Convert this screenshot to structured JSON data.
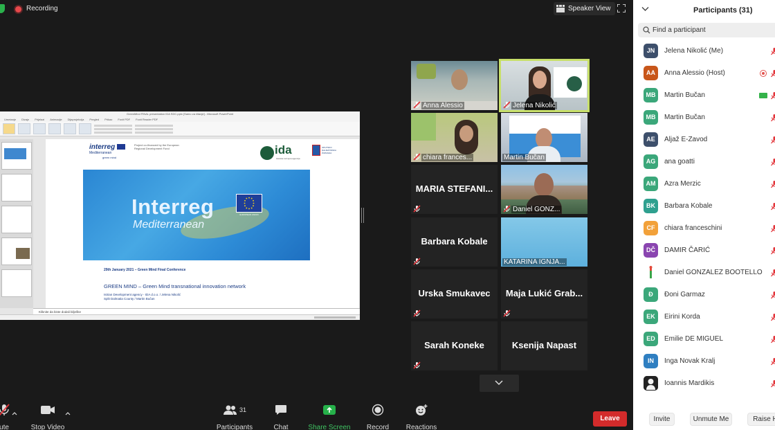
{
  "topbar": {
    "recording_label": "Recording",
    "speaker_view_label": "Speaker View"
  },
  "shared_screen": {
    "window_title": "GreenMind FINAL presentation IDA SDC.pptx [Samo za čitanje] - Microsoft PowerPoint",
    "tabs": [
      "Umetanje",
      "Dizajn",
      "Prijelazi",
      "Animacije",
      "Dijaprojekcija",
      "Pregled",
      "Prikaz",
      "Foxit PDF",
      "Foxit Reader PDF"
    ],
    "slide": {
      "interreg_logo": "interreg",
      "interreg_logo_sub": "Mediterranean",
      "greenmind_logo": "green mind",
      "project_funding": "Project co-financed by the European Regional Development Fund",
      "ida_logo": "ida",
      "ida_sub": "istarska razvojna agencija",
      "county_logo": "SPLITSKO DALMATINSKA ŽUPANIJA",
      "banner_title": "Interreg",
      "banner_sub": "Mediterranean",
      "eu_label": "EUROPEAN UNION",
      "date_line": "29th January 2021 – Green Mind Final Conference",
      "heading": "GREEN MIND – Green Mind transnational innovation network",
      "line1": "Istrian Development agency - IDA d.o.o. / Jelena Nikolić",
      "line2": "Split Dalmatia County / Martin Bučan"
    },
    "notes_placeholder": "Kliknite da biste dodali bilješke"
  },
  "video_grid": [
    {
      "name": "Anna Alessio",
      "type": "video",
      "muted": true
    },
    {
      "name": "Jelena Nikolić",
      "type": "video",
      "muted": true,
      "active": true
    },
    {
      "name": "chiara frances...",
      "type": "video",
      "muted": true
    },
    {
      "name": "Martin Bučan",
      "type": "video",
      "muted": false
    },
    {
      "name": "MARIA STEFANI...",
      "type": "name",
      "muted": true
    },
    {
      "name": "Daniel GONZ...",
      "type": "video",
      "muted": true
    },
    {
      "name": "Barbara Kobale",
      "type": "name",
      "muted": true
    },
    {
      "name": "KATARINA IGNJA...",
      "type": "video",
      "muted": false
    },
    {
      "name": "Urska Smukavec",
      "type": "name",
      "muted": true
    },
    {
      "name": "Maja Lukić Grab...",
      "type": "name",
      "muted": true
    },
    {
      "name": "Sarah Koneke",
      "type": "name",
      "muted": true
    },
    {
      "name": "Ksenija Napast",
      "type": "name",
      "muted": false
    }
  ],
  "toolbar": {
    "mute_label": "ute",
    "stop_video_label": "Stop Video",
    "participants_label": "Participants",
    "participants_count": "31",
    "chat_label": "Chat",
    "share_screen_label": "Share Screen",
    "record_label": "Record",
    "reactions_label": "Reactions",
    "leave_label": "Leave"
  },
  "panel": {
    "title": "Participants (31)",
    "search_placeholder": "Find a participant",
    "participants": [
      {
        "initials": "JN",
        "name": "Jelena Nikolić (Me)",
        "color": "#3d4f6b"
      },
      {
        "initials": "AA",
        "name": "Anna Alessio (Host)",
        "color": "#c8561a",
        "status": "recording"
      },
      {
        "initials": "MB",
        "name": "Martin Bučan",
        "color": "#3ba77a",
        "status": "video"
      },
      {
        "initials": "MB",
        "name": "Martin Bučan",
        "color": "#3ba77a"
      },
      {
        "initials": "AE",
        "name": "Aljaž E-Zavod",
        "color": "#3d4f6b"
      },
      {
        "initials": "AG",
        "name": "ana goatti",
        "color": "#3ba77a"
      },
      {
        "initials": "AM",
        "name": "Azra Merzic",
        "color": "#3ba77a"
      },
      {
        "initials": "BK",
        "name": "Barbara Kobale",
        "color": "#2fa08f"
      },
      {
        "initials": "CF",
        "name": "chiara franceschini",
        "color": "#f2a13a"
      },
      {
        "initials": "DČ",
        "name": "DAMIR ČARIĆ",
        "color": "#8a45b0"
      },
      {
        "initials": "",
        "name": "Daniel GONZALEZ BOOTELLO",
        "color": "#ffffff",
        "photo": true
      },
      {
        "initials": "Đ",
        "name": "Đoni Garmaz",
        "color": "#3ba77a"
      },
      {
        "initials": "EK",
        "name": "Eirini Korda",
        "color": "#3ba77a"
      },
      {
        "initials": "ED",
        "name": "Emilie DE MIGUEL",
        "color": "#3ba77a"
      },
      {
        "initials": "IN",
        "name": "Inga Novak Kralj",
        "color": "#2f7fc1"
      },
      {
        "initials": "",
        "name": "Ioannis Mardikis",
        "color": "#222222",
        "photo": true
      }
    ],
    "footer": {
      "invite_label": "Invite",
      "unmute_me_label": "Unmute Me",
      "raise_hand_label": "Raise H"
    }
  }
}
